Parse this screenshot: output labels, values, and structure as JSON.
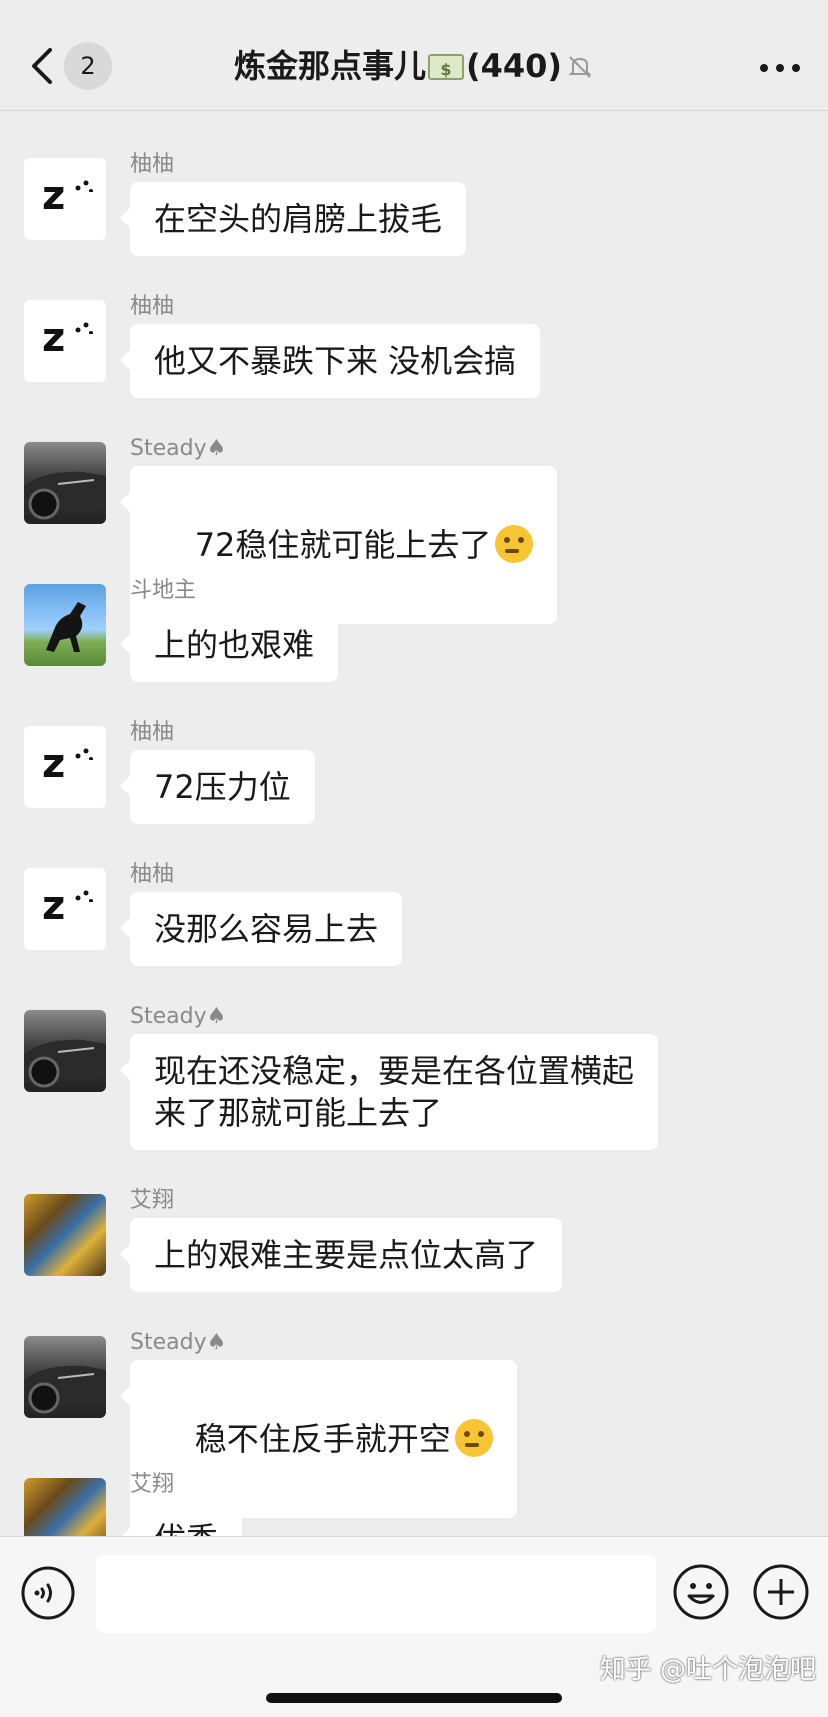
{
  "header": {
    "unread_count": "2",
    "title": "炼金那点事儿",
    "member_count": "(440)"
  },
  "messages": [
    {
      "sender": "柚柚",
      "text": "在空头的肩膀上拔毛",
      "avatar": "z-sleep"
    },
    {
      "sender": "柚柚",
      "text": "他又不暴跌下来 没机会搞",
      "avatar": "z-sleep"
    },
    {
      "sender": "Steady♠",
      "text": "72稳住就可能上去了",
      "avatar": "car",
      "emoji": "thinking-face"
    },
    {
      "sender": "斗地主",
      "text": "上的也艰难",
      "avatar": "horse"
    },
    {
      "sender": "柚柚",
      "text": "72压力位",
      "avatar": "z-sleep"
    },
    {
      "sender": "柚柚",
      "text": "没那么容易上去",
      "avatar": "z-sleep"
    },
    {
      "sender": "Steady♠",
      "text": "现在还没稳定，要是在各位置横起\n来了那就可能上去了",
      "avatar": "car"
    },
    {
      "sender": "艾翔",
      "text": "上的艰难主要是点位太高了",
      "avatar": "tree"
    },
    {
      "sender": "Steady♠",
      "text": "稳不住反手就开空",
      "avatar": "car",
      "emoji": "thinking-face"
    },
    {
      "sender": "艾翔",
      "text": "优秀",
      "avatar": "tree"
    }
  ],
  "input": {
    "placeholder": ""
  },
  "watermark": "知乎 @吐个泡泡吧",
  "colors": {
    "background": "#ededed",
    "bubble": "#ffffff",
    "name_text": "#8a8a8a"
  }
}
